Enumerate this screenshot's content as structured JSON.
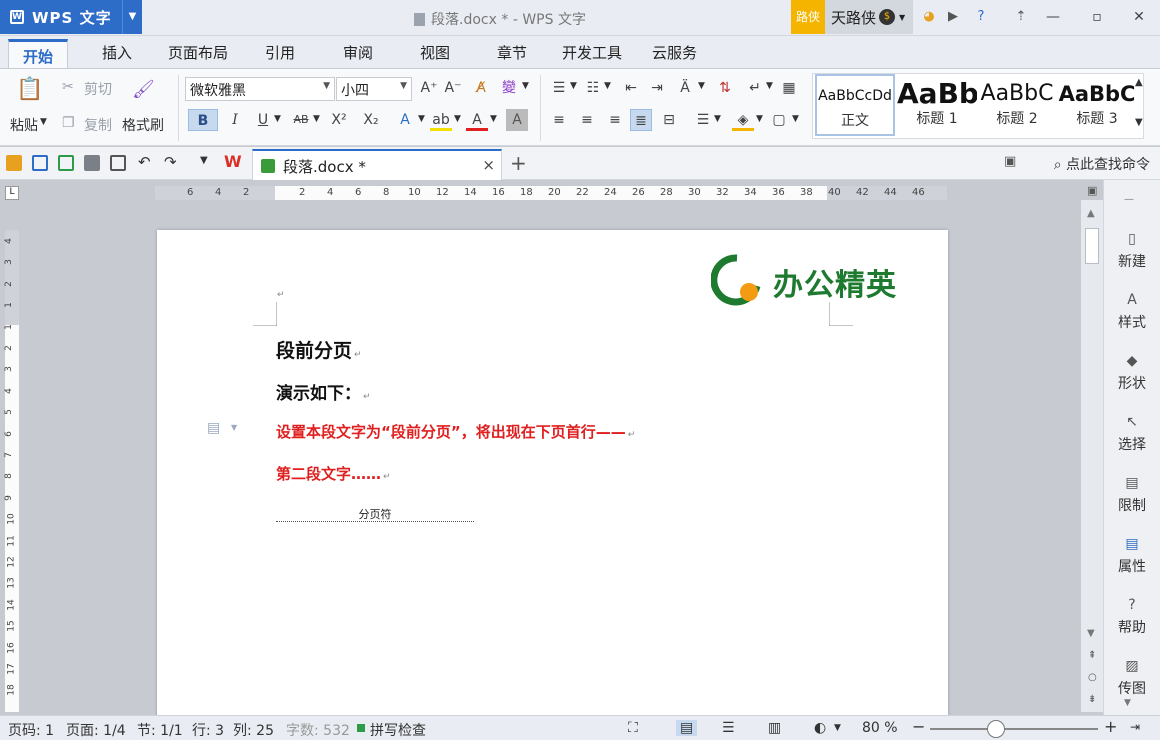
{
  "app": {
    "brand": "WPS 文字",
    "logo_glyph": "W",
    "title": "段落.docx * - WPS 文字",
    "user_tag": "路侠",
    "user_name": "天路侠"
  },
  "menu_tabs": [
    "开始",
    "插入",
    "页面布局",
    "引用",
    "审阅",
    "视图",
    "章节",
    "开发工具",
    "云服务"
  ],
  "ribbon": {
    "paste": "粘贴",
    "cut": "剪切",
    "copy": "复制",
    "format_painter": "格式刷",
    "font_name": "微软雅黑",
    "font_size": "小四",
    "pinyin": "變",
    "styles": [
      {
        "sample": "AaBbCcDd",
        "name": "正文"
      },
      {
        "sample": "AaBb",
        "name": "标题 1"
      },
      {
        "sample": "AaBbC",
        "name": "标题 2"
      },
      {
        "sample": "AaBbC",
        "name": "标题 3"
      }
    ]
  },
  "quickbar": {
    "doc_tab": "段落.docx *",
    "close": "×",
    "add": "+",
    "find_command": "点此查找命令"
  },
  "ruler": {
    "h_ticks": [
      "6",
      "4",
      "2",
      "2",
      "4",
      "6",
      "8",
      "10",
      "12",
      "14",
      "16",
      "18",
      "20",
      "22",
      "24",
      "26",
      "28",
      "30",
      "32",
      "34",
      "36",
      "38",
      "40",
      "42",
      "44",
      "46"
    ],
    "v_ticks": [
      "4",
      "3",
      "2",
      "1",
      "1",
      "2",
      "3",
      "4",
      "5",
      "6",
      "7",
      "8",
      "9",
      "10",
      "11",
      "12",
      "13",
      "14",
      "15",
      "16",
      "17",
      "18"
    ]
  },
  "document": {
    "logo_text": "办公精英",
    "heading1": "段前分页",
    "heading2": "演示如下：",
    "para1": "设置本段文字为“段前分页”，将出现在下页首行——",
    "para2": "第二段文字……",
    "page_break": "分页符",
    "para_mark": "↵"
  },
  "sidebar": [
    "新建",
    "样式",
    "形状",
    "选择",
    "限制",
    "属性",
    "帮助",
    "传图"
  ],
  "status": {
    "page_code": "页码: 1",
    "page": "页面: 1/4",
    "section": "节: 1/1",
    "row": "行: 3",
    "col": "列: 25",
    "word_count": "字数: 532",
    "spell": "拼写检查",
    "zoom": "80 %"
  },
  "colors": {
    "accent": "#2d6cc7",
    "red_text": "#e02020",
    "logo_green": "#1d7a2e",
    "logo_orange": "#f39c12"
  }
}
